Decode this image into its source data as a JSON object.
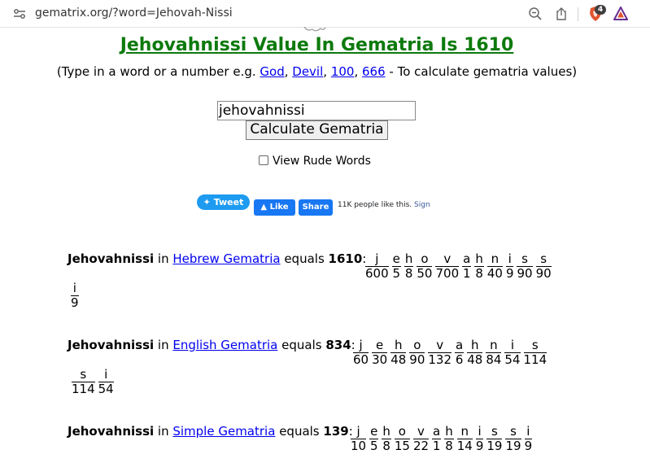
{
  "browser": {
    "url": "gematrix.org/?word=Jehovah-Nissi",
    "brave_badge": "4"
  },
  "page": {
    "title": "Jehovahnissi Value In Gematria Is 1610",
    "instructions_prefix": "(Type in a word or a number e.g. ",
    "examples": [
      "God",
      "Devil",
      "100",
      "666"
    ],
    "instructions_suffix": " - To calculate gematria values)",
    "input_value": "jehovahnissi",
    "calculate_label": "Calculate Gematria",
    "rude_words_label": "View Rude Words",
    "rude_words_checked": false
  },
  "social": {
    "tweet_label": "Tweet",
    "like_label": "Like",
    "share_label": "Share",
    "fb_text": "11K people like this.",
    "fb_sign": "Sign"
  },
  "results": [
    {
      "word": "Jehovahnissi",
      "system": "Hebrew Gematria",
      "total": "1610",
      "letters": [
        "j",
        "e",
        "h",
        "o",
        "v",
        "a",
        "h",
        "n",
        "i",
        "s",
        "s",
        "i"
      ],
      "values": [
        "600",
        "5",
        "8",
        "50",
        "700",
        "1",
        "8",
        "40",
        "9",
        "90",
        "90",
        "9"
      ]
    },
    {
      "word": "Jehovahnissi",
      "system": "English Gematria",
      "total": "834",
      "letters": [
        "j",
        "e",
        "h",
        "o",
        "v",
        "a",
        "h",
        "n",
        "i",
        "s",
        "s",
        "i"
      ],
      "values": [
        "60",
        "30",
        "48",
        "90",
        "132",
        "6",
        "48",
        "84",
        "54",
        "114",
        "114",
        "54"
      ]
    },
    {
      "word": "Jehovahnissi",
      "system": "Simple Gematria",
      "total": "139",
      "letters": [
        "j",
        "e",
        "h",
        "o",
        "v",
        "a",
        "h",
        "n",
        "i",
        "s",
        "s",
        "i"
      ],
      "values": [
        "10",
        "5",
        "8",
        "15",
        "22",
        "1",
        "8",
        "14",
        "9",
        "19",
        "19",
        "9"
      ]
    }
  ],
  "text": {
    "in": " in ",
    "equals": " equals ",
    "colon": ":"
  }
}
